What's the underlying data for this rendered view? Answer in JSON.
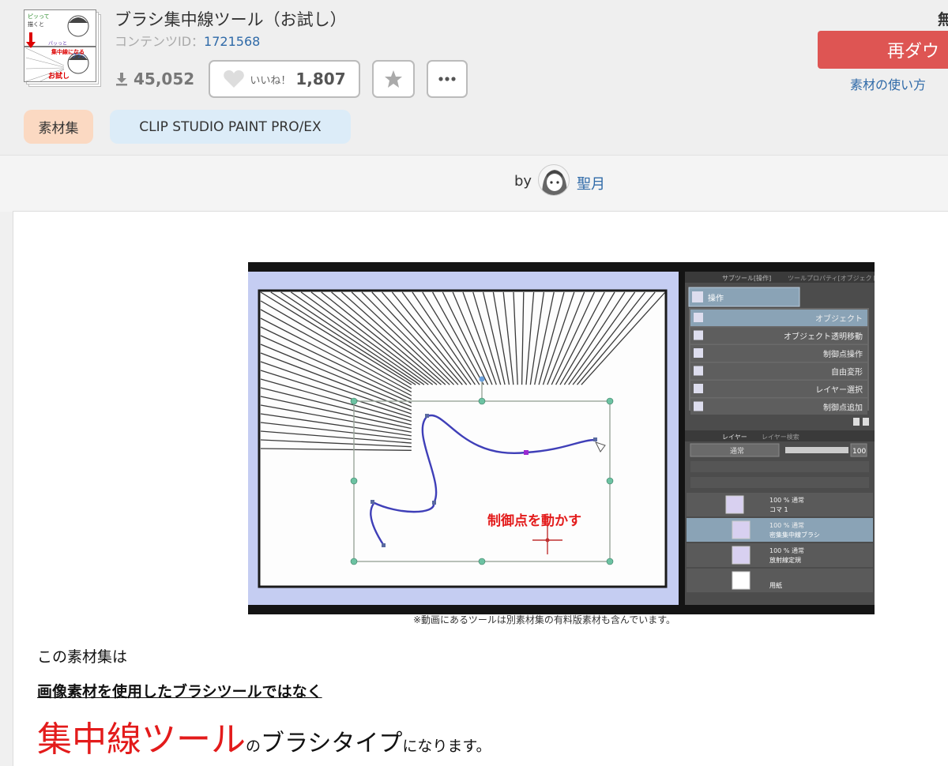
{
  "header": {
    "title": "ブラシ集中線ツール（お試し）",
    "content_id_label": "コンテンツID：",
    "content_id": "1721568",
    "downloads": "45,052",
    "like_label": "いいね！",
    "like_count": "1,807",
    "free_label": "無",
    "redownload_label": "再ダウ",
    "howto_label": "素材の使い方",
    "tags": [
      "素材集",
      "CLIP STUDIO PAINT PRO/EX"
    ]
  },
  "thumbnail": {
    "line1": "ピッって",
    "line2": "描くと",
    "line3": "パッっと",
    "line4": "集中線になる",
    "line5": "ブラシ",
    "line6": "お試し"
  },
  "author": {
    "by": "by",
    "name": "聖月"
  },
  "video": {
    "tool_panel_title": "サブツール[操作]",
    "tool_panel_tab2": "ツールプロパティ[オブジェクト]",
    "tool_group": "操作",
    "tools": [
      "オブジェクト",
      "オブジェクト透明移動",
      "制御点操作",
      "自由変形",
      "レイヤー選択",
      "制御点追加"
    ],
    "layer_tab1": "レイヤー",
    "layer_tab2": "レイヤー検索",
    "blend_mode": "通常",
    "opacity": "100",
    "layers": [
      {
        "info": "100 % 通常",
        "name": "コマ 1"
      },
      {
        "info": "100 % 通常",
        "name": "密集集中線ブラシ"
      },
      {
        "info": "100 % 通常",
        "name": "放射線定規"
      },
      {
        "info": "",
        "name": "用紙"
      }
    ],
    "canvas_label": "制御点を動かす"
  },
  "body": {
    "caption": "※動画にあるツールは別素材集の有料版素材も含んでいます。",
    "p1": "この素材集は",
    "p2": "画像素材を使用したブラシツールではなく",
    "p3_big": "集中線ツール",
    "p3_a": "の",
    "p3_mid1": "ブラシタイプ",
    "p3_b": "になります。"
  },
  "colors": {
    "accent_red": "#de5553",
    "link": "#2f6aa8",
    "tag_orange": "#fbd9c2",
    "tag_blue": "#dcecf8",
    "highlight_red": "#e31b1b"
  }
}
